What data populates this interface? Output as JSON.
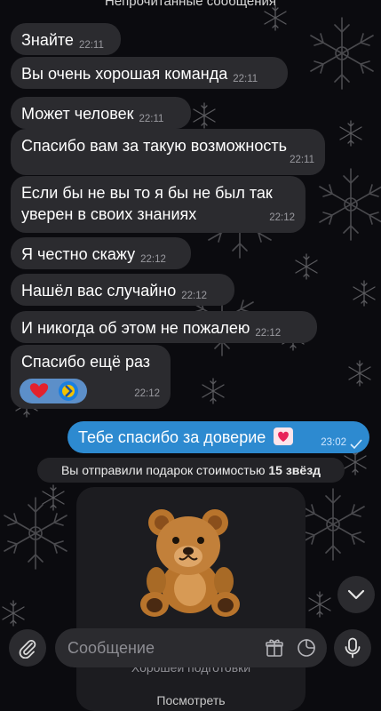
{
  "header": {
    "unread_label": "Непрочитанные сообщения"
  },
  "messages": [
    {
      "text": "Знайте",
      "time": "22:11"
    },
    {
      "text": "Вы очень хорошая команда",
      "time": "22:11"
    },
    {
      "text": "Может человек",
      "time": "22:11"
    },
    {
      "text": "Спасибо вам за такую возможность",
      "time": "22:11"
    },
    {
      "line1": "Если бы не вы то я бы не был так",
      "line2": "уверен в своих знаниях",
      "time": "22:12"
    },
    {
      "text": "Я честно скажу",
      "time": "22:12"
    },
    {
      "text": "Нашёл вас случайно",
      "time": "22:12"
    },
    {
      "text": "И никогда об этом не пожалею",
      "time": "22:12"
    },
    {
      "text": "Спасибо ещё раз",
      "time": "22:12"
    }
  ],
  "outgoing": {
    "text": "Тебе спасибо за доверие",
    "time": "23:02",
    "emoji": "heart-emoji"
  },
  "service": {
    "prefix": "Вы отправили подарок стоимостью",
    "amount": "15 звёзд"
  },
  "gift": {
    "subtitle": "Хорошей подготовки",
    "button": "Посмотреть",
    "icon": "teddy-bear"
  },
  "input": {
    "placeholder": "Сообщение"
  },
  "colors": {
    "background": "#0b0b0f",
    "incoming_bubble": "#2b2b2f",
    "outgoing_bubble": "#2d8ad0"
  }
}
